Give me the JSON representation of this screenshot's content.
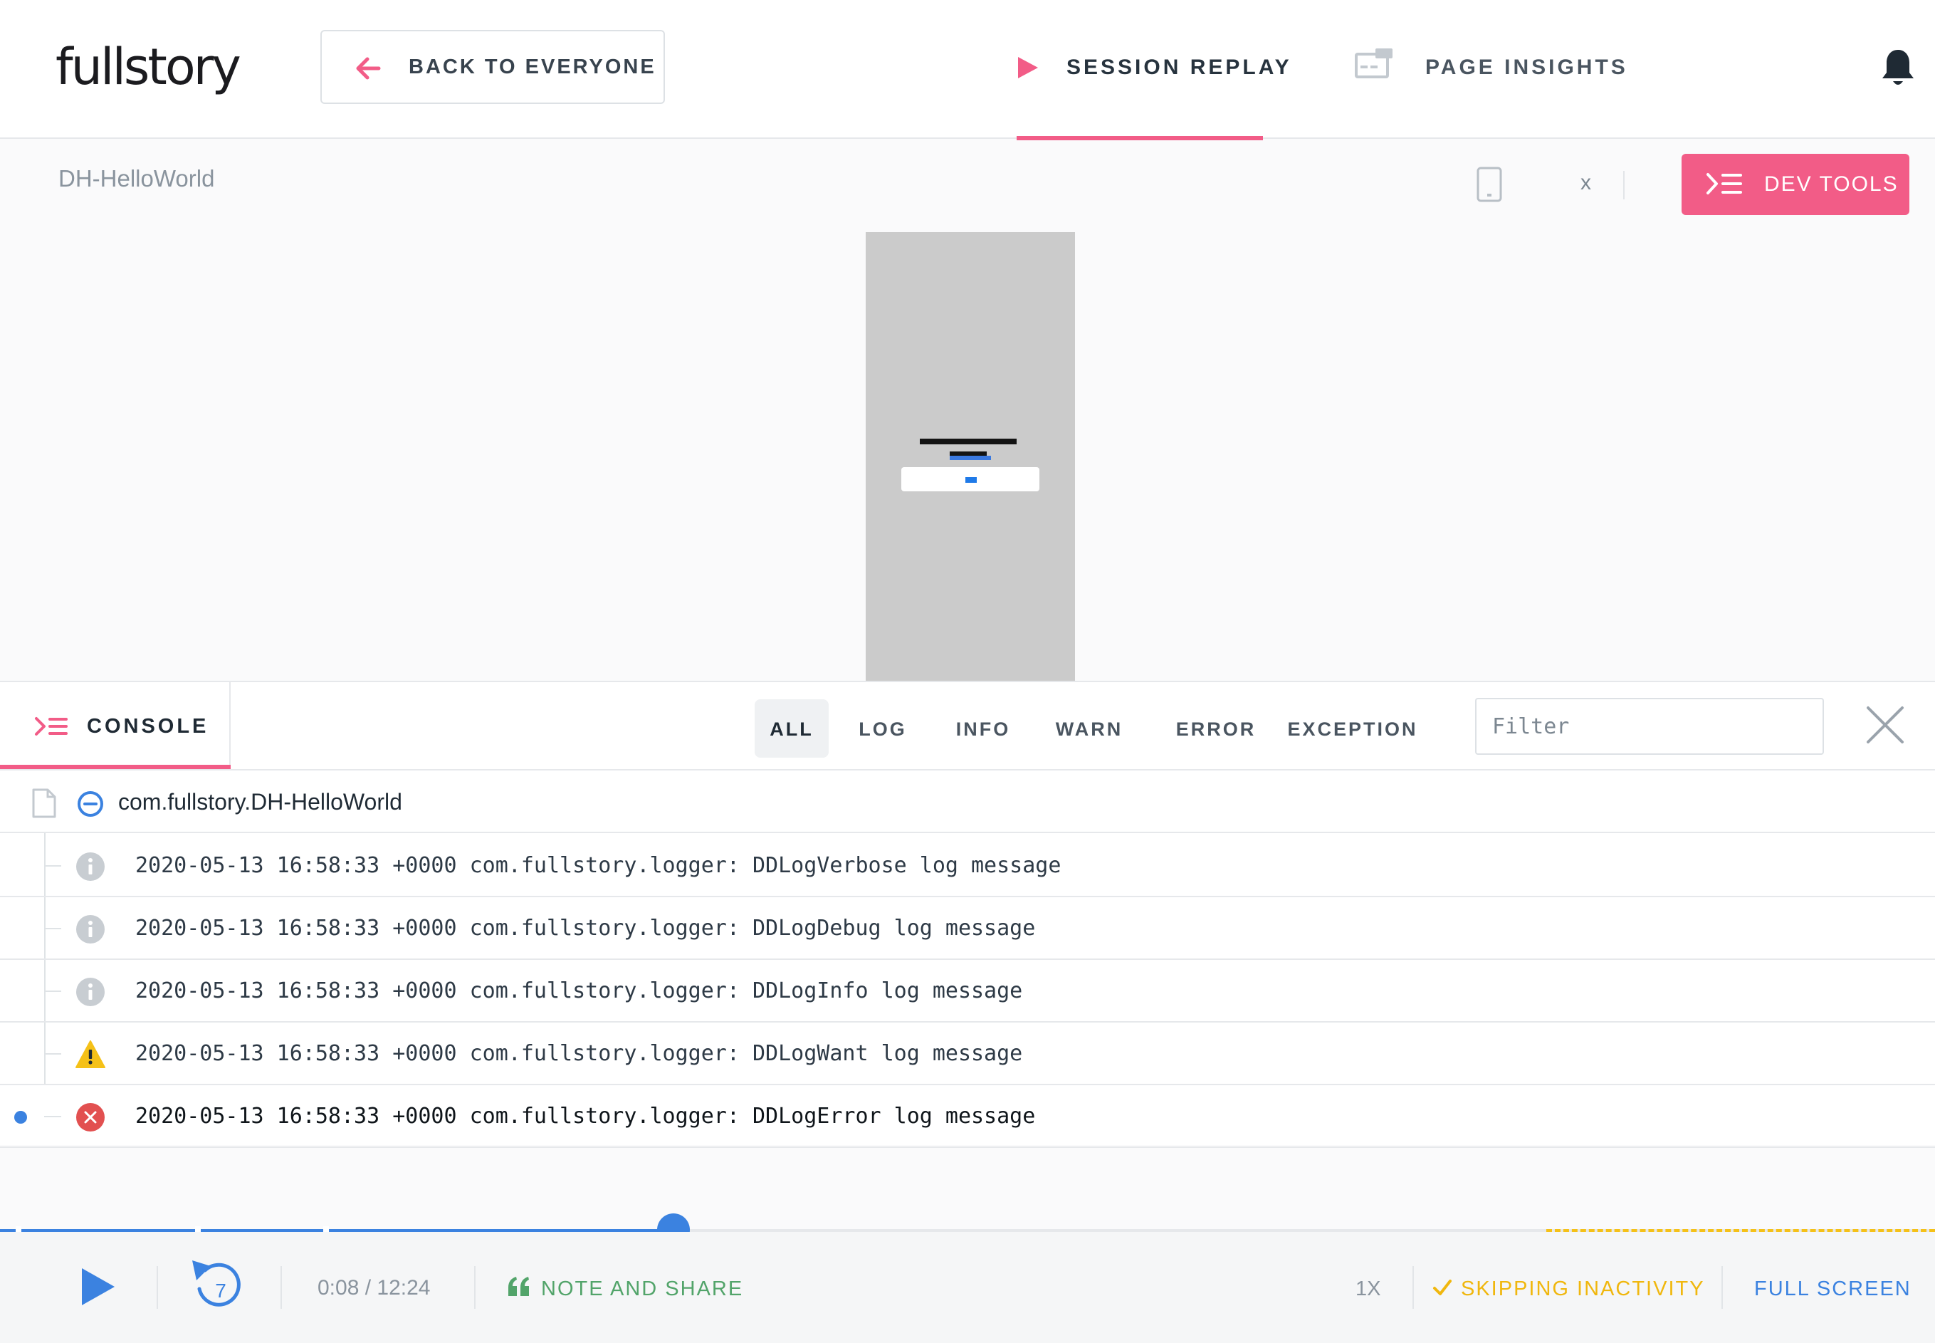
{
  "header": {
    "logo": "fullstory",
    "back_label": "BACK TO EVERYONE",
    "tabs": [
      {
        "label": "SESSION REPLAY",
        "active": true
      },
      {
        "label": "PAGE INSIGHTS",
        "active": false
      }
    ]
  },
  "session": {
    "name": "DH-HelloWorld",
    "close_label": "x",
    "devtools_label": "DEV TOOLS"
  },
  "console": {
    "tab_label": "CONSOLE",
    "filters": [
      "ALL",
      "LOG",
      "INFO",
      "WARN",
      "ERROR",
      "EXCEPTION"
    ],
    "active_filter": "ALL",
    "filter_placeholder": "Filter",
    "source": "com.fullstory.DH-HelloWorld",
    "entries": [
      {
        "level": "info",
        "message": "2020-05-13 16:58:33 +0000 com.fullstory.logger: DDLogVerbose log message"
      },
      {
        "level": "info",
        "message": "2020-05-13 16:58:33 +0000 com.fullstory.logger: DDLogDebug log message"
      },
      {
        "level": "info",
        "message": "2020-05-13 16:58:33 +0000 com.fullstory.logger: DDLogInfo log message"
      },
      {
        "level": "warn",
        "message": "2020-05-13 16:58:33 +0000 com.fullstory.logger: DDLogWant log message"
      },
      {
        "level": "error",
        "message": "2020-05-13 16:58:33 +0000 com.fullstory.logger: DDLogError log message"
      }
    ]
  },
  "player": {
    "rewind_seconds": "7",
    "time": "0:08 / 12:24",
    "progress_fraction": 0.348,
    "note_share_label": "NOTE AND SHARE",
    "speed": "1X",
    "skipping_label": "SKIPPING INACTIVITY",
    "fullscreen_label": "FULL SCREEN"
  },
  "colors": {
    "accent_pink": "#f25c87",
    "accent_blue": "#3b82e0",
    "note_green": "#52a46a",
    "skip_yellow": "#f0b70e",
    "error_red": "#e25050",
    "warn_yellow": "#f5c118"
  }
}
